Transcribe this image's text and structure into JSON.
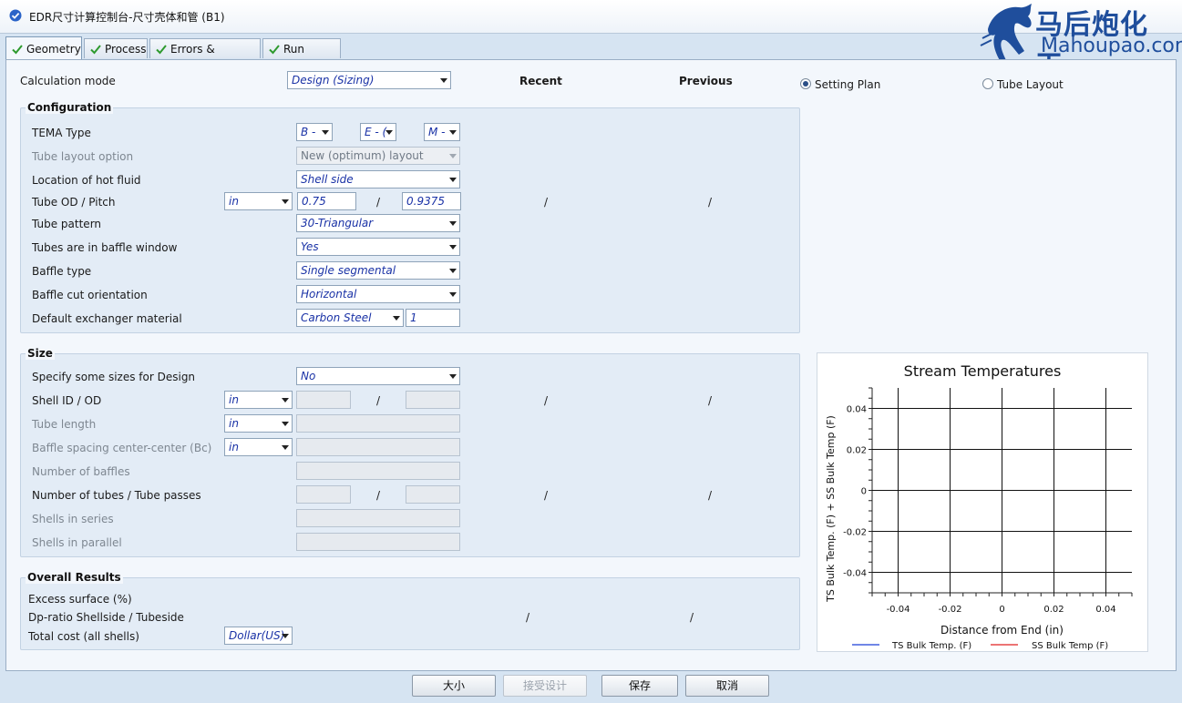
{
  "window": {
    "title": "EDR尺寸计算控制台-尺寸壳体和管 (B1)"
  },
  "logo": {
    "cn": "马后炮化工",
    "en": "Mahoupao.com"
  },
  "tabs": [
    {
      "label": "Geometry"
    },
    {
      "label": "Process"
    },
    {
      "label": "Errors & Warnings"
    },
    {
      "label": "Run Status"
    }
  ],
  "header": {
    "calc_mode_label": "Calculation mode",
    "calc_mode_value": "Design (Sizing)",
    "recent": "Recent",
    "previous": "Previous",
    "radio_setting_plan": "Setting Plan",
    "radio_tube_layout": "Tube Layout"
  },
  "configuration": {
    "title": "Configuration",
    "tema_label": "TEMA Type",
    "tema_front": "B -",
    "tema_shell": "E - (",
    "tema_rear": "M -",
    "tube_layout_label": "Tube layout option",
    "tube_layout_value": "New (optimum) layout",
    "hot_fluid_label": "Location of hot fluid",
    "hot_fluid_value": "Shell side",
    "od_pitch_label": "Tube OD / Pitch",
    "od_pitch_unit": "in",
    "od_value": "0.75",
    "pitch_value": "0.9375",
    "tube_pattern_label": "Tube pattern",
    "tube_pattern_value": "30-Triangular",
    "baffle_window_label": "Tubes are in baffle window",
    "baffle_window_value": "Yes",
    "baffle_type_label": "Baffle type",
    "baffle_type_value": "Single segmental",
    "baffle_cut_label": "Baffle cut orientation",
    "baffle_cut_value": "Horizontal",
    "material_label": "Default exchanger material",
    "material_value": "Carbon Steel",
    "material_code": "1"
  },
  "size": {
    "title": "Size",
    "specify_label": "Specify some sizes for Design",
    "specify_value": "No",
    "shell_id_label": "Shell ID / OD",
    "shell_id_unit": "in",
    "tube_length_label": "Tube length",
    "tube_length_unit": "in",
    "baffle_spacing_label": "Baffle spacing center-center (Bc)",
    "baffle_spacing_unit": "in",
    "num_baffles_label": "Number of baffles",
    "num_tubes_label": "Number of tubes / Tube passes",
    "shells_series_label": "Shells in series",
    "shells_parallel_label": "Shells in parallel"
  },
  "overall": {
    "title": "Overall Results",
    "excess_label": "Excess surface (%)",
    "dp_ratio_label": "Dp-ratio Shellside / Tubeside",
    "cost_label": "Total cost (all shells)",
    "cost_unit": "Dollar(US)"
  },
  "slash": "/",
  "chart_data": {
    "type": "line",
    "title": "Stream Temperatures",
    "xlabel": "Distance from End (in)",
    "ylabel": "TS Bulk Temp. (F) + SS Bulk Temp (F)",
    "xlim": [
      -0.05,
      0.05
    ],
    "ylim": [
      -0.05,
      0.05
    ],
    "xticks": [
      "-0.04",
      "-0.02",
      "0",
      "0.02",
      "0.04"
    ],
    "yticks": [
      "0.04",
      "0.02",
      "0",
      "-0.02",
      "-0.04"
    ],
    "grid": true,
    "legend_position": "bottom",
    "series": [
      {
        "name": "TS Bulk Temp. (F)",
        "color": "#1a3fd6",
        "x": [],
        "y": []
      },
      {
        "name": "SS Bulk Temp (F)",
        "color": "#e02020",
        "x": [],
        "y": []
      }
    ]
  },
  "buttons": {
    "size": "大小",
    "accept": "接受设计",
    "save": "保存",
    "cancel": "取消"
  }
}
